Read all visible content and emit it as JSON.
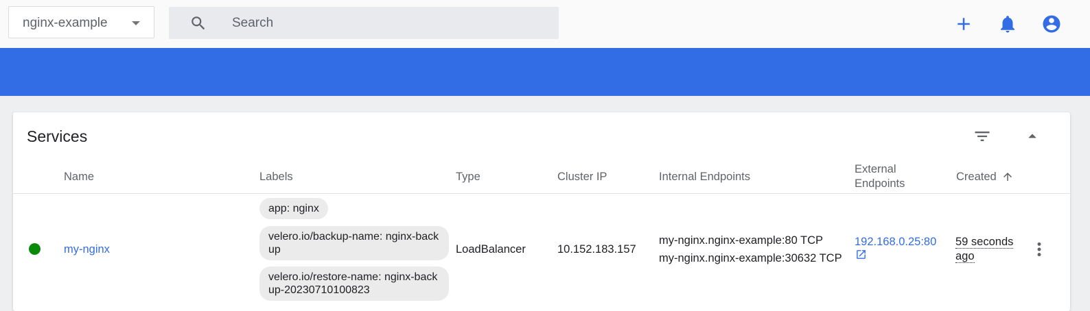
{
  "topbar": {
    "namespace": "nginx-example",
    "search_placeholder": "Search",
    "icons": [
      "search-icon",
      "add-icon",
      "bell-icon",
      "account-circle-icon"
    ]
  },
  "colors": {
    "accent": "#326de6",
    "status_running": "#0a8a0a"
  },
  "services": {
    "title": "Services",
    "columns": {
      "name": "Name",
      "labels": "Labels",
      "type": "Type",
      "cluster_ip": "Cluster IP",
      "internal_endpoints": "Internal Endpoints",
      "external_endpoints_1": "External",
      "external_endpoints_2": "Endpoints",
      "created": "Created"
    },
    "sort": {
      "column": "created",
      "direction": "ascending"
    },
    "rows": [
      {
        "status": "running",
        "name": "my-nginx",
        "labels": [
          "app: nginx",
          "velero.io/backup-name: nginx-backup",
          "velero.io/restore-name: nginx-backup-20230710100823"
        ],
        "type": "LoadBalancer",
        "cluster_ip": "10.152.183.157",
        "internal_endpoints": [
          "my-nginx.nginx-example:80 TCP",
          "my-nginx.nginx-example:30632 TCP"
        ],
        "external_endpoint": "192.168.0.25:80",
        "created": "59 seconds ago"
      }
    ]
  }
}
